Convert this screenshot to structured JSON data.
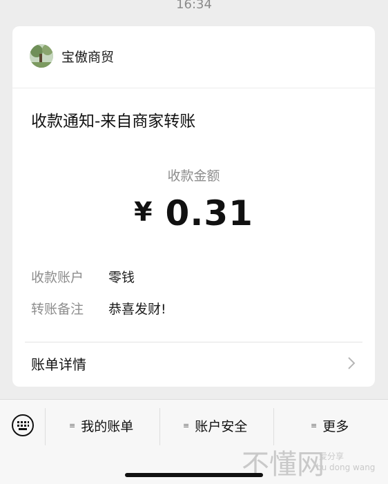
{
  "status_bar": {
    "time": "16:34"
  },
  "merchant": {
    "name": "宝傲商贸"
  },
  "notice": {
    "title": "收款通知-来自商家转账",
    "amount_label": "收款金额",
    "currency": "¥",
    "amount": "0.31",
    "rows": [
      {
        "key": "收款账户",
        "value": "零钱"
      },
      {
        "key": "转账备注",
        "value": "恭喜发财!"
      }
    ],
    "detail_label": "账单详情"
  },
  "bottom_menu": {
    "items": [
      {
        "label": "我的账单"
      },
      {
        "label": "账户安全"
      },
      {
        "label": "更多"
      }
    ],
    "menu_icon": "≡"
  },
  "watermark": {
    "big": "不懂网",
    "small1": "爱分享",
    "small2": "bu dong wang"
  },
  "colors": {
    "background": "#ededed",
    "card": "#ffffff",
    "muted_text": "#8d8d8d"
  }
}
